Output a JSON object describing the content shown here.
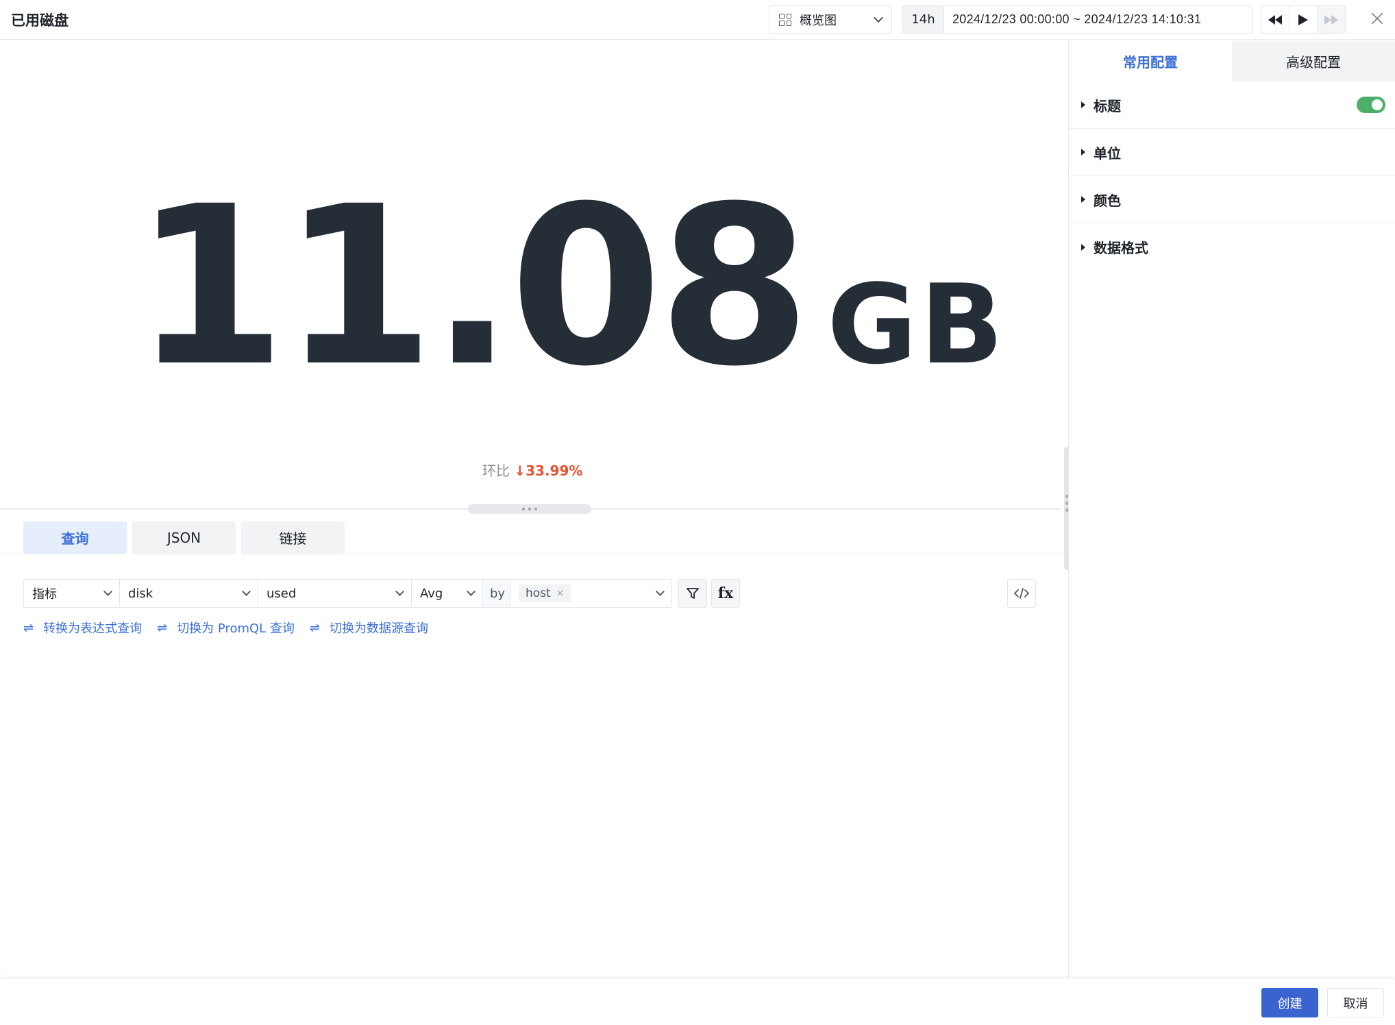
{
  "header": {
    "title": "已用磁盘",
    "view_select": "概览图",
    "time_preset": "14h",
    "time_range": "2024/12/23 00:00:00 ~ 2024/12/23 14:10:31"
  },
  "preview": {
    "value": "11.08",
    "unit": "GB",
    "compare_label": "环比",
    "compare_arrow": "↓",
    "compare_value": "33.99%",
    "compare_color": "#e2532f"
  },
  "query_tabs": [
    "查询",
    "JSON",
    "链接"
  ],
  "query": {
    "type": "指标",
    "measurement": "disk",
    "field": "used",
    "aggregation": "Avg",
    "by_label": "by",
    "group_tag": "host",
    "tag_remove": "×",
    "filter_icon": "filter-icon",
    "fx_label": "fx",
    "code_icon": "code-icon"
  },
  "switch_links": [
    "转换为表达式查询",
    "切换为 PromQL 查询",
    "切换为数据源查询"
  ],
  "right_panel": {
    "tabs": [
      "常用配置",
      "高级配置"
    ],
    "sections": [
      "标题",
      "单位",
      "颜色",
      "数据格式"
    ]
  },
  "footer": {
    "create": "创建",
    "cancel": "取消"
  },
  "colors": {
    "accent": "#3a6fd8",
    "primary_button": "#3a63cf",
    "toggle_on": "#4caf6a",
    "value_text": "#252d36"
  }
}
